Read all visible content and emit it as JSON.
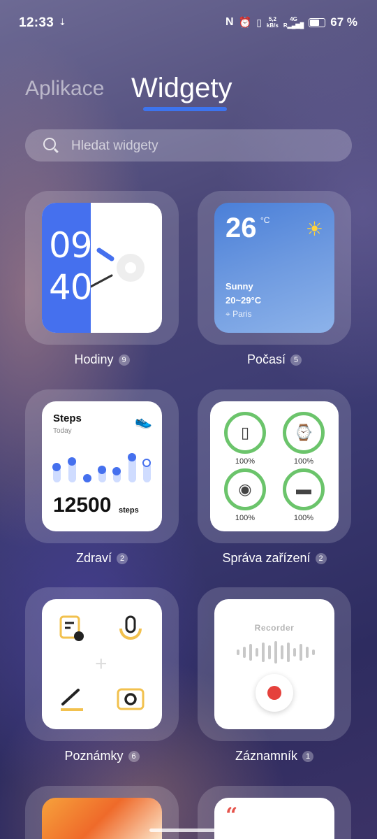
{
  "status_bar": {
    "time": "12:33",
    "speed": "5,2",
    "speed_unit": "kB/s",
    "network": "4G",
    "battery_pct": "67 %",
    "battery_level": 0.67
  },
  "tabs": {
    "apps": "Aplikace",
    "widgets": "Widgety"
  },
  "search": {
    "placeholder": "Hledat widgety"
  },
  "widgets": {
    "clock": {
      "name": "Hodiny",
      "count": "9",
      "hour": "09",
      "minute": "40"
    },
    "weather": {
      "name": "Počasí",
      "count": "5",
      "temp": "26",
      "unit": "°C",
      "condition": "Sunny",
      "range": "20~29°C",
      "city": "Paris"
    },
    "health": {
      "name": "Zdraví",
      "count": "2",
      "title": "Steps",
      "subtitle": "Today",
      "steps": "12500",
      "steps_unit": "steps"
    },
    "devices": {
      "name": "Správa zařízení",
      "count": "2",
      "items": [
        {
          "icon": "phone-icon",
          "pct": "100%"
        },
        {
          "icon": "watch-icon",
          "pct": "100%"
        },
        {
          "icon": "earbuds-icon",
          "pct": "100%"
        },
        {
          "icon": "earbuds-case-icon",
          "pct": "100%"
        }
      ]
    },
    "notes": {
      "name": "Poznámky",
      "count": "6"
    },
    "recorder": {
      "name": "Záznamník",
      "count": "1",
      "title": "Recorder"
    }
  },
  "colors": {
    "accent": "#3d74ee",
    "ring": "#6bc46b",
    "record": "#e5413c"
  }
}
